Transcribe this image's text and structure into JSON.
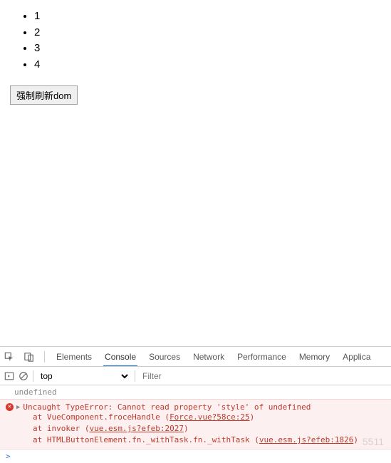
{
  "page": {
    "list_items": [
      "1",
      "2",
      "3",
      "4"
    ],
    "button_label": "强制刷新dom"
  },
  "devtools": {
    "tabs": {
      "elements": "Elements",
      "console": "Console",
      "sources": "Sources",
      "network": "Network",
      "performance": "Performance",
      "memory": "Memory",
      "application": "Applica"
    },
    "active_tab": "console",
    "subbar": {
      "context": "top",
      "filter_placeholder": "Filter"
    },
    "console": {
      "log_undefined": "undefined",
      "error": {
        "message": "Uncaught TypeError: Cannot read property 'style' of undefined",
        "trace": [
          {
            "prefix": "at VueComponent.froceHandle (",
            "link": "Force.vue?58ce:25",
            "suffix": ")"
          },
          {
            "prefix": "at invoker (",
            "link": "vue.esm.js?efeb:2027",
            "suffix": ")"
          },
          {
            "prefix": "at HTMLButtonElement.fn._withTask.fn._withTask (",
            "link": "vue.esm.js?efeb:1826",
            "suffix": ")"
          }
        ]
      },
      "prompt": ">"
    },
    "watermark": "5511"
  }
}
